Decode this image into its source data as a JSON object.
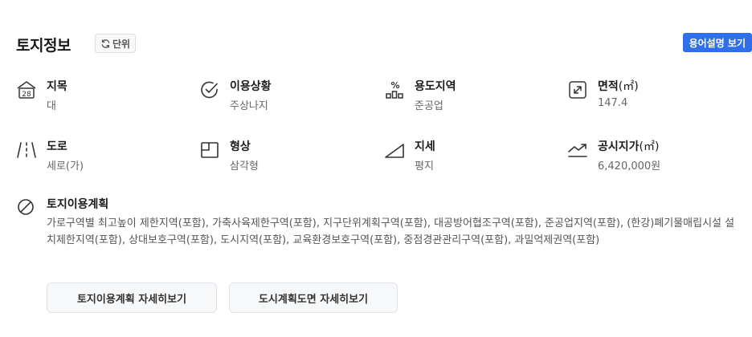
{
  "header": {
    "title": "토지정보",
    "unit_button": "단위",
    "guide_button": "용어설명 보기"
  },
  "grid": [
    {
      "icon": "land-category-icon",
      "label": "지목",
      "unit": "",
      "value": "대"
    },
    {
      "icon": "check-circle-icon",
      "label": "이용상황",
      "unit": "",
      "value": "주상나지"
    },
    {
      "icon": "zoning-percent-icon",
      "label": "용도지역",
      "unit": "",
      "value": "준공업"
    },
    {
      "icon": "expand-area-icon",
      "label": "면적",
      "unit": "(㎡)",
      "value": "147.4"
    },
    {
      "icon": "road-icon",
      "label": "도로",
      "unit": "",
      "value": "세로(가)"
    },
    {
      "icon": "shape-icon",
      "label": "형상",
      "unit": "",
      "value": "삼각형"
    },
    {
      "icon": "slope-icon",
      "label": "지세",
      "unit": "",
      "value": "평지"
    },
    {
      "icon": "trend-up-icon",
      "label": "공시지가",
      "unit": "(㎡)",
      "value": "6,420,000원"
    }
  ],
  "plan": {
    "icon": "prohibited-icon",
    "label": "토지이용계획",
    "value": "가로구역별 최고높이 제한지역(포함), 가축사육제한구역(포함), 지구단위계획구역(포함), 대공방어협조구역(포함), 준공업지역(포함), (한강)폐기물매립시설 설치제한지역(포함), 상대보호구역(포함), 도시지역(포함), 교육환경보호구역(포함), 중점경관관리구역(포함), 과밀억제권역(포함)"
  },
  "actions": {
    "land_use_detail": "토지이용계획 자세히보기",
    "urban_plan_detail": "도시계획도면 자세히보기"
  }
}
